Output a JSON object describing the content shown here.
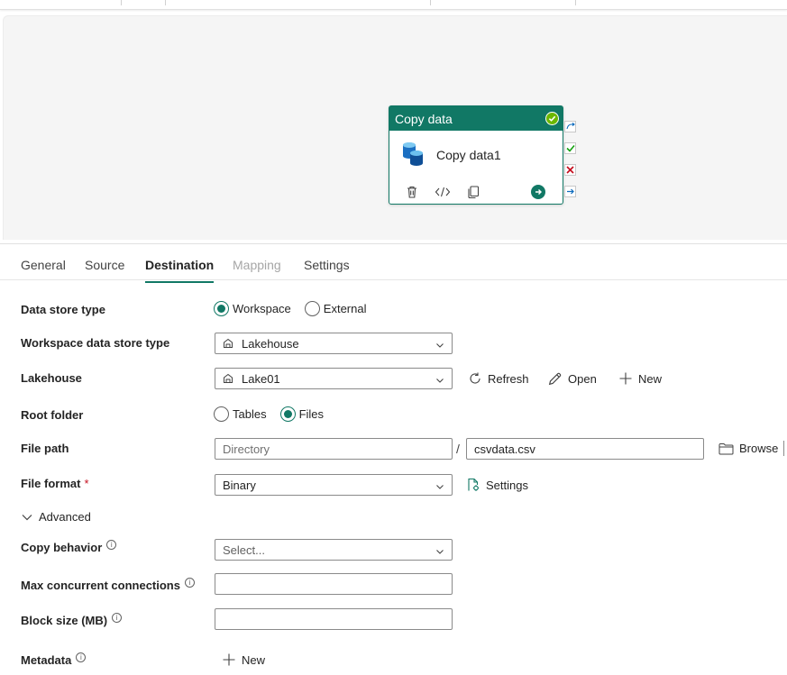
{
  "canvas": {
    "activity": {
      "type_label": "Copy data",
      "name": "Copy data1"
    }
  },
  "tabs": [
    {
      "label": "General",
      "state": "normal"
    },
    {
      "label": "Source",
      "state": "normal"
    },
    {
      "label": "Destination",
      "state": "active"
    },
    {
      "label": "Mapping",
      "state": "disabled"
    },
    {
      "label": "Settings",
      "state": "normal"
    }
  ],
  "form": {
    "data_store_type": {
      "label": "Data store type",
      "options": [
        "Workspace",
        "External"
      ],
      "selected": "Workspace"
    },
    "workspace_store_type": {
      "label": "Workspace data store type",
      "value": "Lakehouse"
    },
    "lakehouse": {
      "label": "Lakehouse",
      "value": "Lake01",
      "refresh_label": "Refresh",
      "open_label": "Open",
      "new_label": "New"
    },
    "root_folder": {
      "label": "Root folder",
      "options": [
        "Tables",
        "Files"
      ],
      "selected": "Files"
    },
    "file_path": {
      "label": "File path",
      "directory_placeholder": "Directory",
      "separator": "/",
      "file_value": "csvdata.csv",
      "browse_label": "Browse"
    },
    "file_format": {
      "label": "File format",
      "required_mark": "*",
      "value": "Binary",
      "settings_label": "Settings"
    },
    "advanced": {
      "label": "Advanced",
      "expanded": true
    },
    "copy_behavior": {
      "label": "Copy behavior",
      "placeholder": "Select..."
    },
    "max_connections": {
      "label": "Max concurrent connections",
      "value": ""
    },
    "block_size": {
      "label": "Block size (MB)",
      "value": ""
    },
    "metadata": {
      "label": "Metadata",
      "new_label": "New"
    }
  },
  "colors": {
    "accent": "#117865",
    "success": "#6bb700",
    "error": "#c50f1f",
    "link_blue": "#0f6cbd"
  }
}
